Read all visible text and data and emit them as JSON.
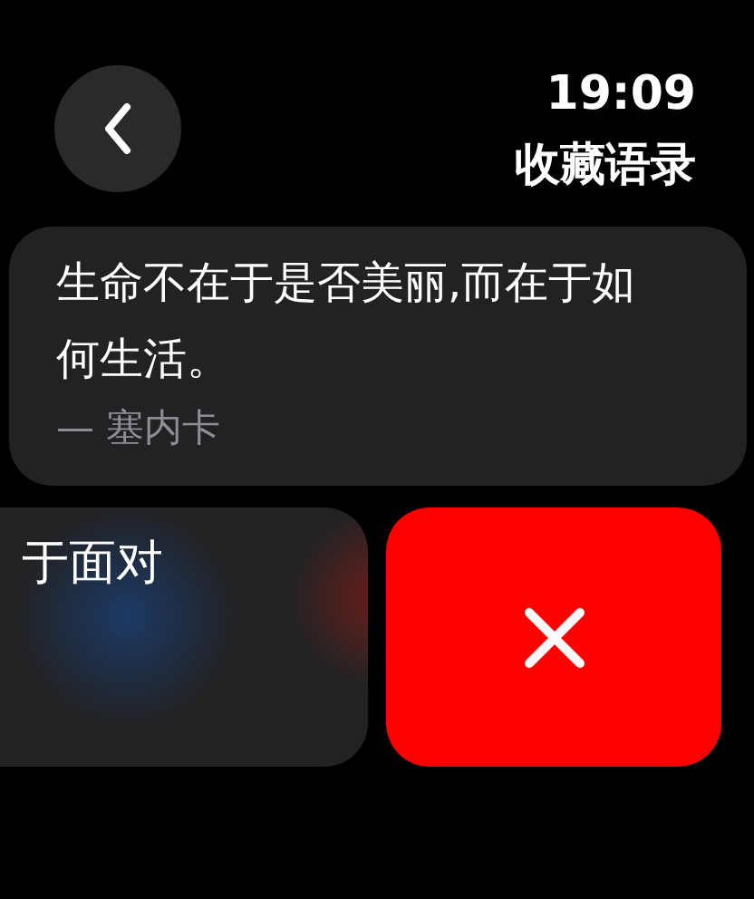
{
  "header": {
    "time": "19:09",
    "title": "收藏语录"
  },
  "quotes": [
    {
      "text": "生命不在于是否美丽,而在于如何生活。",
      "author": "— 塞内卡"
    }
  ],
  "swiped_quote": {
    "text": "于面对"
  }
}
